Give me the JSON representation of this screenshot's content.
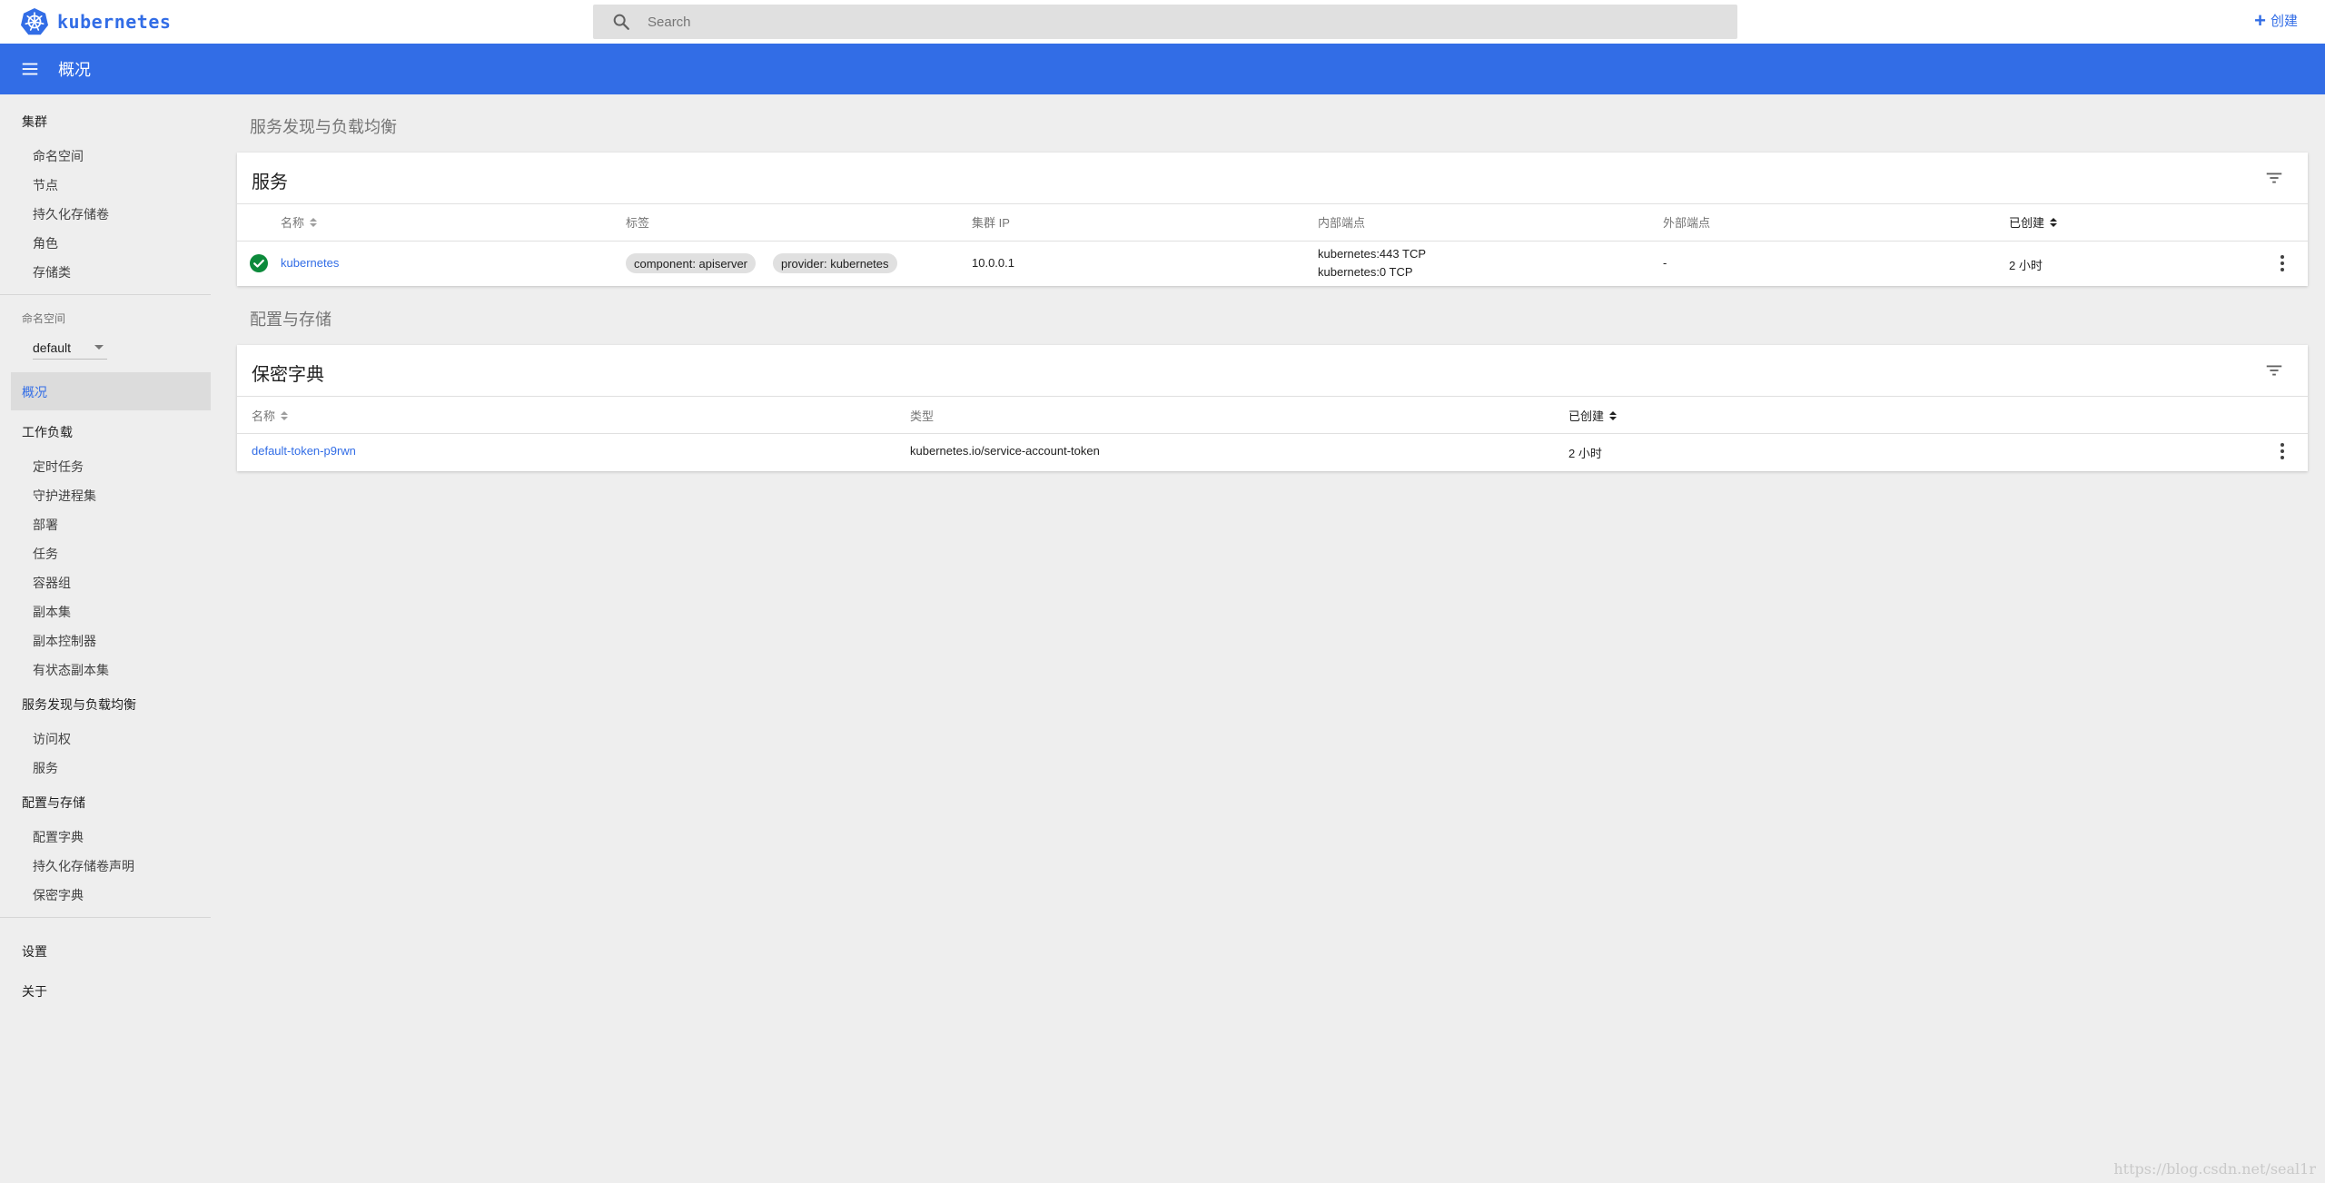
{
  "header": {
    "brand": "kubernetes",
    "search_placeholder": "Search",
    "create_label": "创建",
    "page_title": "概况"
  },
  "sidebar": {
    "cluster": {
      "label": "集群",
      "items": [
        "命名空间",
        "节点",
        "持久化存储卷",
        "角色",
        "存储类"
      ]
    },
    "namespace": {
      "label": "命名空间",
      "selected": "default"
    },
    "overview": "概况",
    "workloads": {
      "label": "工作负载",
      "items": [
        "定时任务",
        "守护进程集",
        "部署",
        "任务",
        "容器组",
        "副本集",
        "副本控制器",
        "有状态副本集"
      ]
    },
    "discovery": {
      "label": "服务发现与负载均衡",
      "items": [
        "访问权",
        "服务"
      ]
    },
    "config": {
      "label": "配置与存储",
      "items": [
        "配置字典",
        "持久化存储卷声明",
        "保密字典"
      ]
    },
    "settings": "设置",
    "about": "关于"
  },
  "main": {
    "discovery_heading": "服务发现与负载均衡",
    "services": {
      "title": "服务",
      "columns": [
        "名称",
        "标签",
        "集群 IP",
        "内部端点",
        "外部端点",
        "已创建"
      ],
      "rows": [
        {
          "name": "kubernetes",
          "labels": [
            "component: apiserver",
            "provider: kubernetes"
          ],
          "cluster_ip": "10.0.0.1",
          "internal_endpoints": [
            "kubernetes:443 TCP",
            "kubernetes:0 TCP"
          ],
          "external_endpoints": "-",
          "created": "2 小时"
        }
      ]
    },
    "config_heading": "配置与存储",
    "secrets": {
      "title": "保密字典",
      "columns": [
        "名称",
        "类型",
        "已创建"
      ],
      "rows": [
        {
          "name": "default-token-p9rwn",
          "type": "kubernetes.io/service-account-token",
          "created": "2 小时"
        }
      ]
    }
  },
  "watermark": "https://blog.csdn.net/seal1r",
  "colors": {
    "accent": "#326de6",
    "status_ok": "#0c8a3b"
  }
}
